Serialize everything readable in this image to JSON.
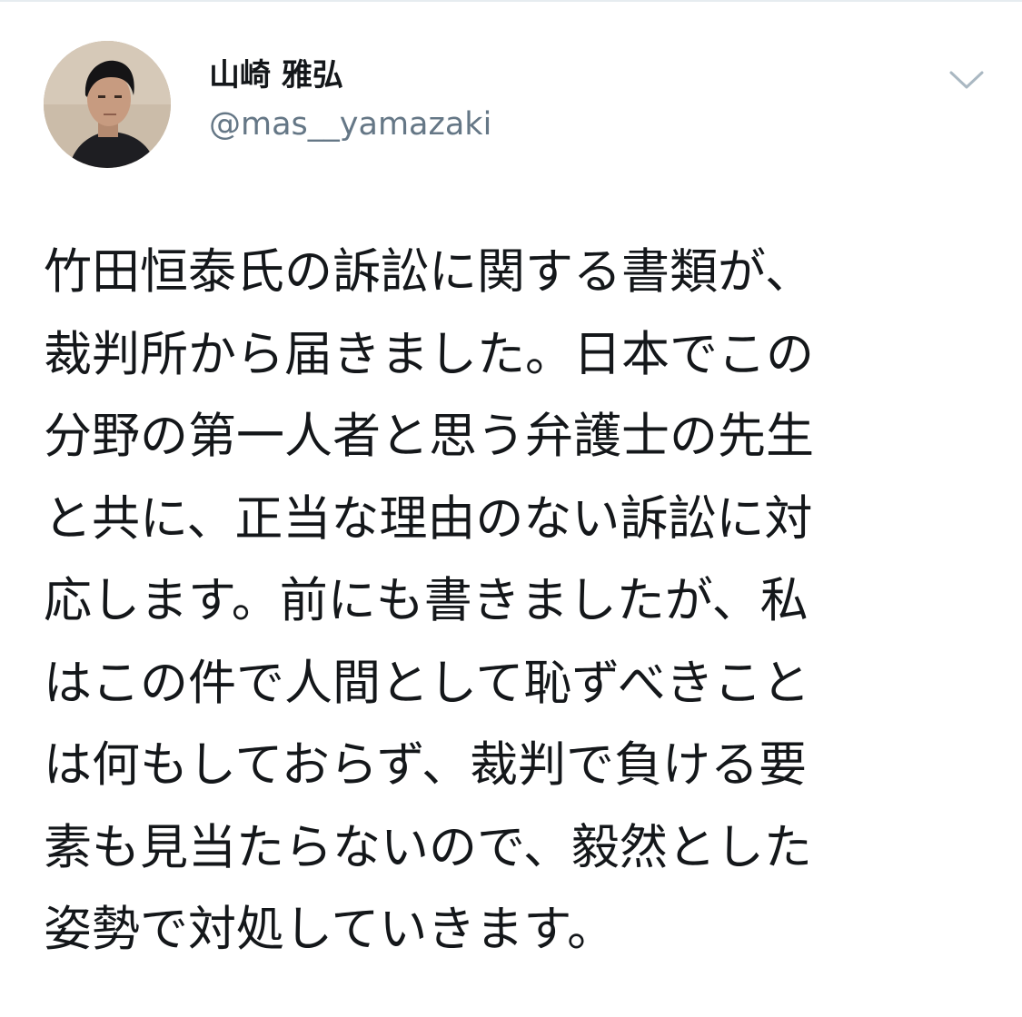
{
  "tweet": {
    "author": {
      "display_name": "山崎 雅弘",
      "handle": "@mas__yamazaki",
      "avatar_icon": "profile-photo"
    },
    "menu_icon": "chevron-down-icon",
    "text_lines": [
      "竹田恒泰氏の訴訟に関する書類が、",
      "裁判所から届きました。日本でこの",
      "分野の第一人者と思う弁護士の先生",
      "と共に、正当な理由のない訴訟に対",
      "応します。前にも書きましたが、私",
      "はこの件で人間として恥ずべきこと",
      "は何もしておらず、裁判で負ける要",
      "素も見当たらないので、毅然とした",
      "姿勢で対処していきます。"
    ]
  },
  "colors": {
    "text_primary": "#14171a",
    "text_secondary": "#657786",
    "caret": "#aab8c2",
    "divider": "#e6ecf0",
    "background": "#ffffff"
  }
}
